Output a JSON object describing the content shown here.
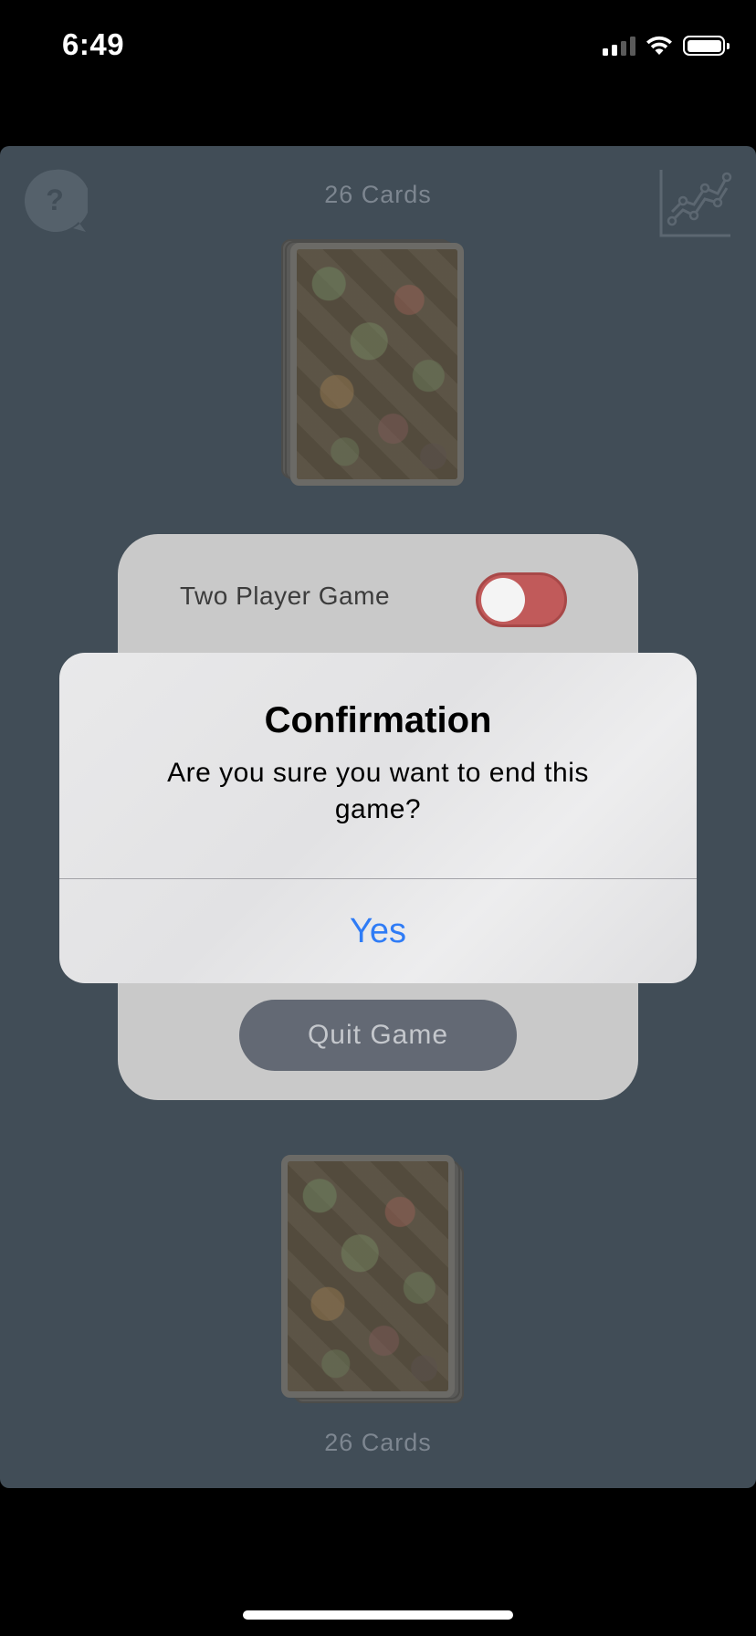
{
  "status_bar": {
    "time": "6:49",
    "icons": [
      "cellular-signal-icon",
      "wifi-icon",
      "battery-icon"
    ]
  },
  "game": {
    "top_card_count": "26 Cards",
    "bottom_card_count": "26 Cards",
    "icons": [
      "help-question-icon",
      "stats-chart-icon"
    ],
    "background_color": "#414d57"
  },
  "settings_panel": {
    "two_player_label": "Two Player Game",
    "two_player_enabled": false,
    "toggle_color": "#c15a5a",
    "quit_label": "Quit Game"
  },
  "alert": {
    "title": "Confirmation",
    "message": "Are you sure you want to end this game?",
    "action_label": "Yes",
    "action_color": "#2f7cf6"
  }
}
